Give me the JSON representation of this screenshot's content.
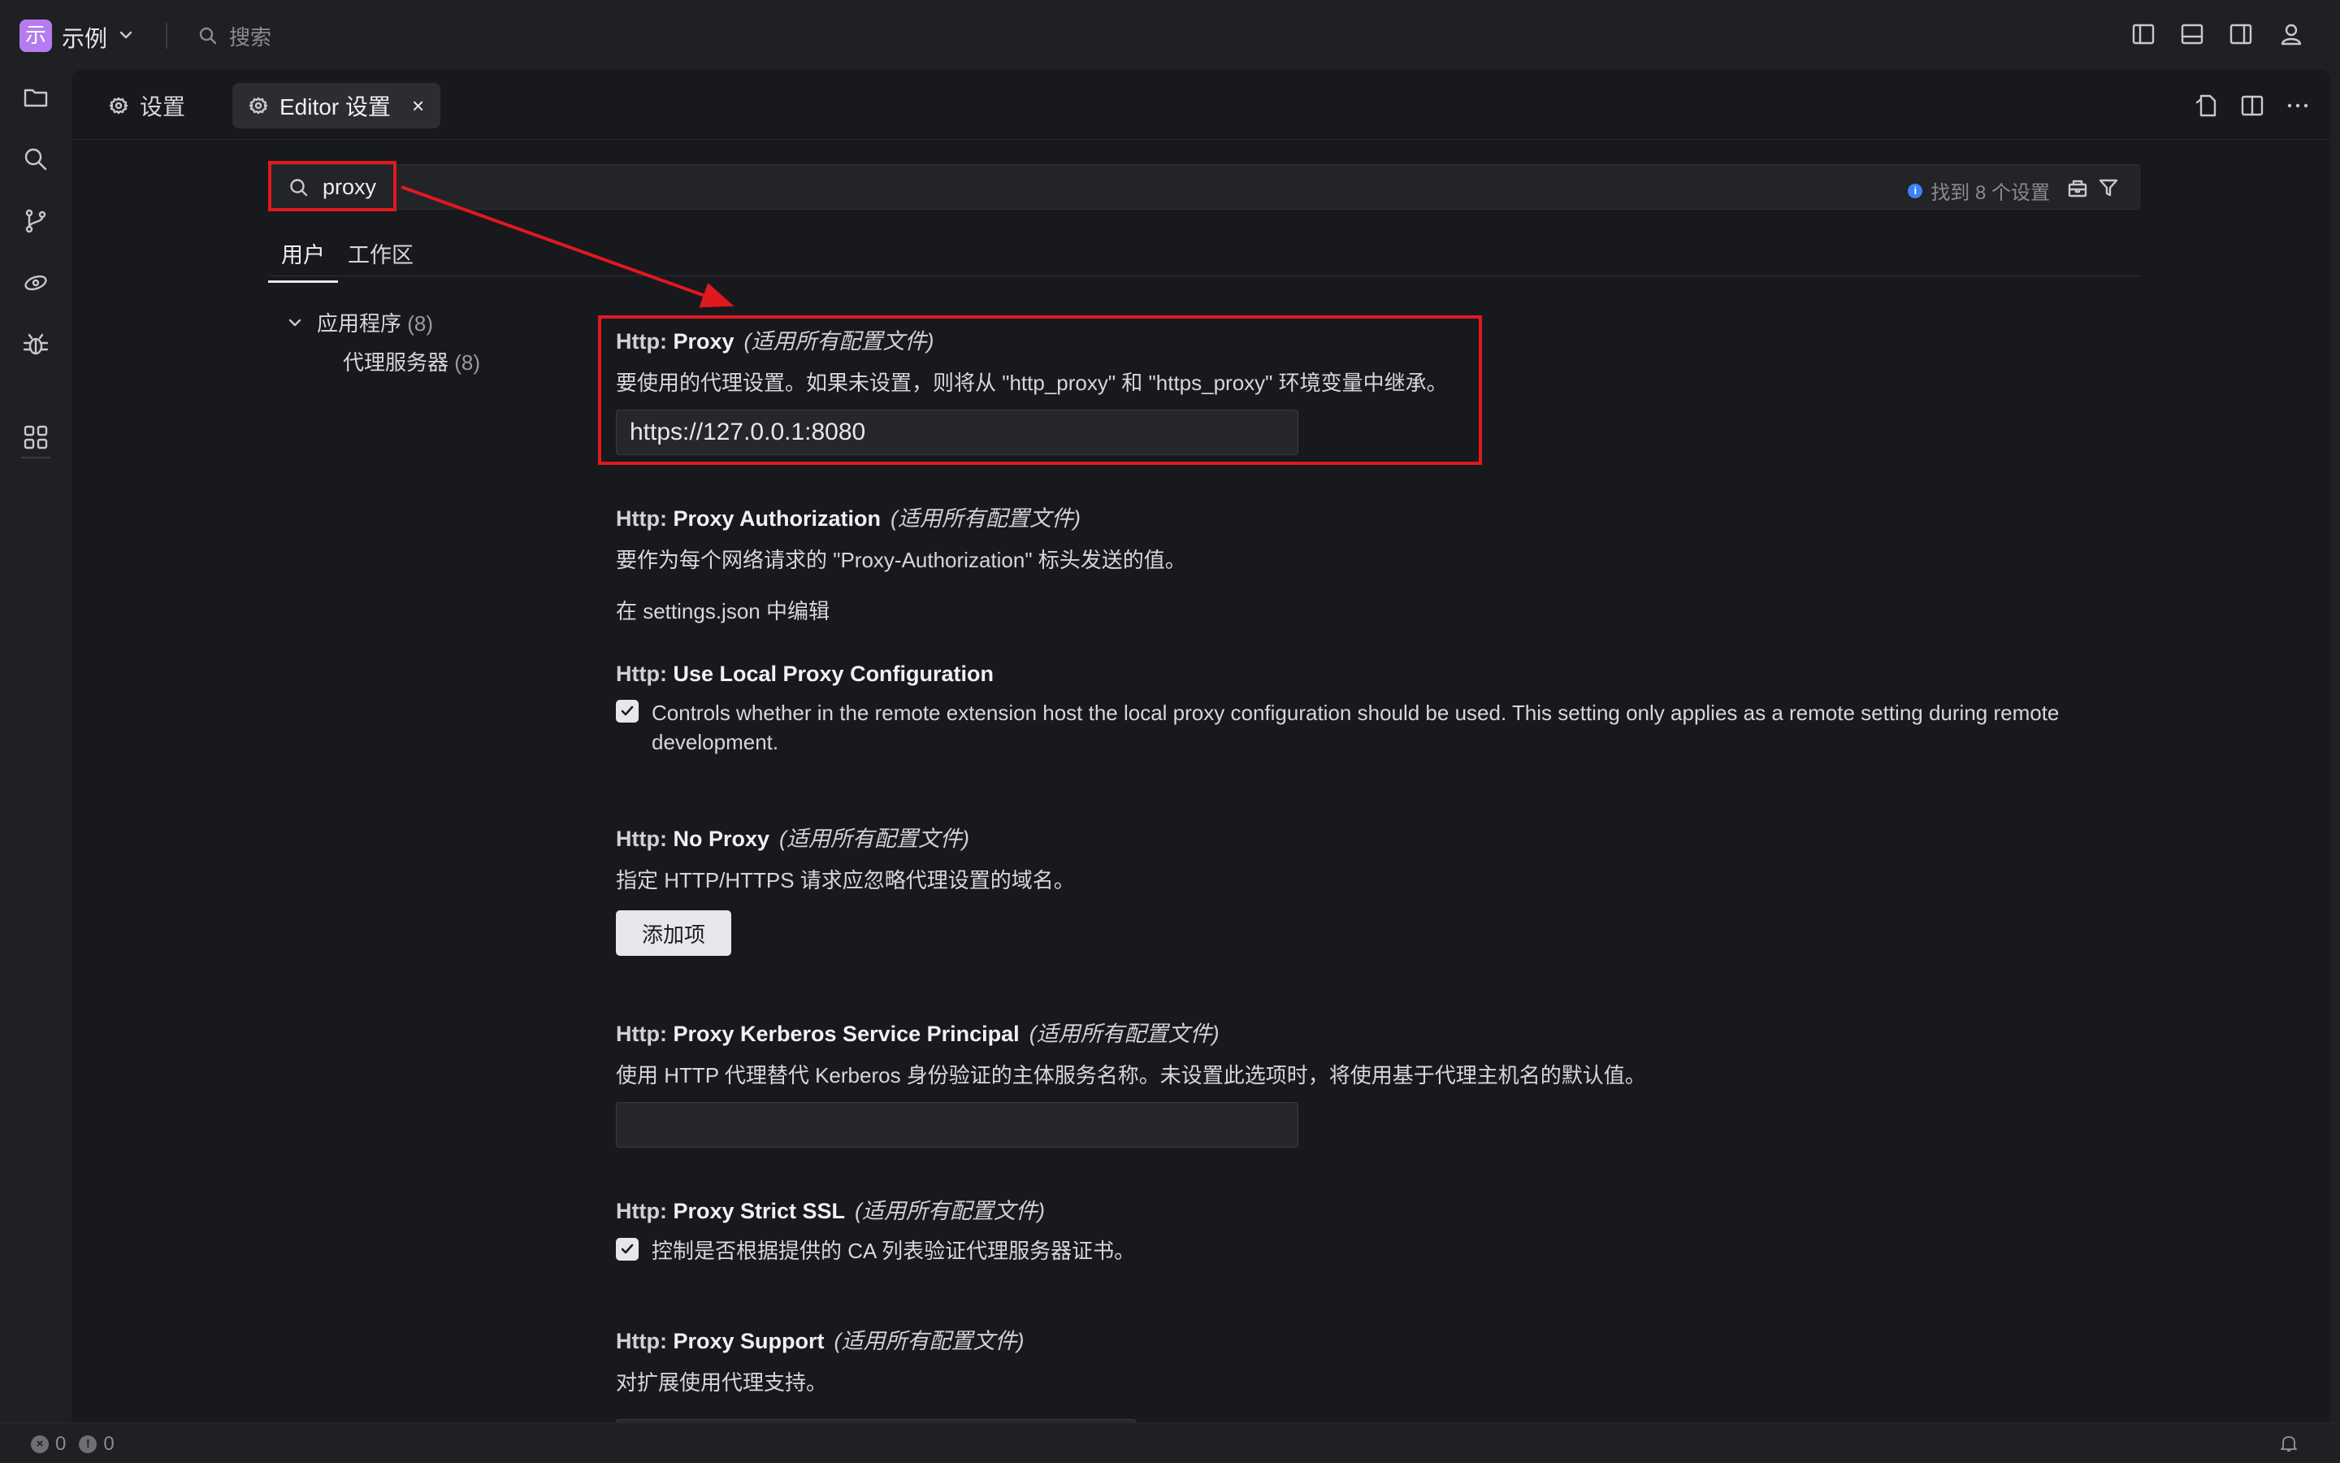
{
  "titlebar": {
    "app_logo_char": "示",
    "app_name": "示例",
    "search_placeholder": "搜索"
  },
  "tabs": [
    {
      "label": "设置",
      "active": false
    },
    {
      "label": "Editor 设置",
      "active": true,
      "close": "×"
    }
  ],
  "search": {
    "query": "proxy",
    "results": "找到 8 个设置"
  },
  "scope_tabs": [
    "用户",
    "工作区"
  ],
  "toc": {
    "group_label": "应用程序",
    "group_count": "(8)",
    "child_label": "代理服务器",
    "child_count": "(8)"
  },
  "settings": [
    {
      "category": "Http: ",
      "name": "Proxy",
      "scope": "(适用所有配置文件)",
      "description": "要使用的代理设置。如果未设置，则将从 \"http_proxy\" 和 \"https_proxy\" 环境变量中继承。",
      "value": "https://127.0.0.1:8080"
    },
    {
      "category": "Http: ",
      "name": "Proxy Authorization",
      "scope": "(适用所有配置文件)",
      "description": "要作为每个网络请求的 \"Proxy-Authorization\" 标头发送的值。",
      "link": "在 settings.json 中编辑"
    },
    {
      "category": "Http: ",
      "name": "Use Local Proxy Configuration",
      "checked": true,
      "description": "Controls whether in the remote extension host the local proxy configuration should be used. This setting only applies as a remote setting during remote development."
    },
    {
      "category": "Http: ",
      "name": "No Proxy",
      "scope": "(适用所有配置文件)",
      "description": "指定 HTTP/HTTPS 请求应忽略代理设置的域名。",
      "button": "添加项"
    },
    {
      "category": "Http: ",
      "name": "Proxy Kerberos Service Principal",
      "scope": "(适用所有配置文件)",
      "description": "使用 HTTP 代理替代 Kerberos 身份验证的主体服务名称。未设置此选项时，将使用基于代理主机名的默认值。",
      "value": ""
    },
    {
      "category": "Http: ",
      "name": "Proxy Strict SSL",
      "scope": "(适用所有配置文件)",
      "checked": true,
      "description": "控制是否根据提供的 CA 列表验证代理服务器证书。"
    },
    {
      "category": "Http: ",
      "name": "Proxy Support",
      "scope": "(适用所有配置文件)",
      "description": "对扩展使用代理支持。"
    }
  ],
  "statusbar": {
    "errors": "0",
    "warnings": "0"
  },
  "colors": {
    "annotation": "#e0191f",
    "logo": "#b57cf0",
    "info": "#3b82f6"
  }
}
